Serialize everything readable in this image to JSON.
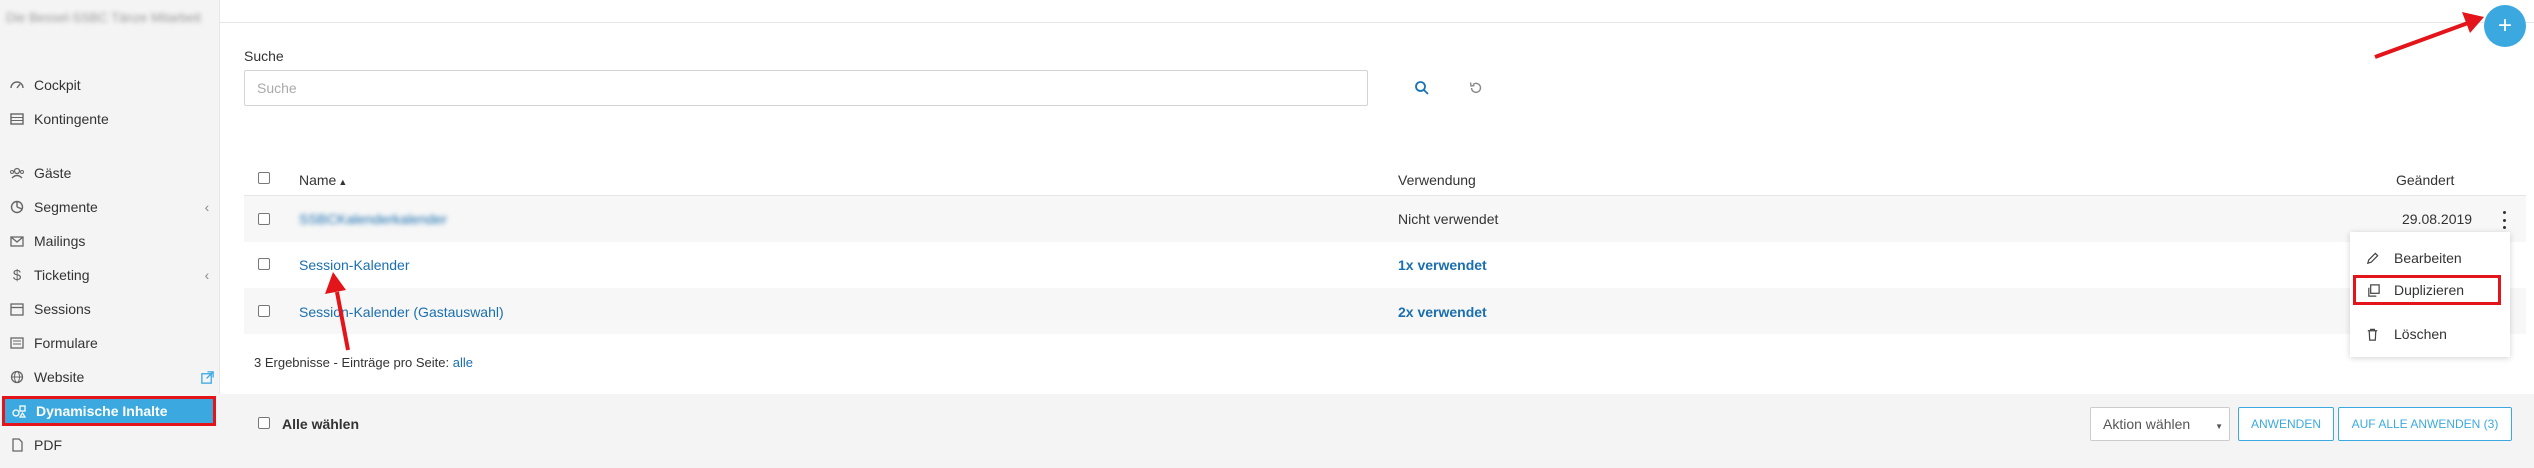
{
  "sidebar": {
    "header": "Die Bessel-SSBC Tänze Mitarbeit",
    "items": [
      {
        "label": "Cockpit",
        "icon": "gauge-icon"
      },
      {
        "label": "Kontingente",
        "icon": "grid-icon"
      },
      {
        "label": "Gäste",
        "icon": "users-icon"
      },
      {
        "label": "Segmente",
        "icon": "segments-icon"
      },
      {
        "label": "Mailings",
        "icon": "mailings-icon"
      },
      {
        "label": "Ticketing",
        "icon": "dollar-icon"
      },
      {
        "label": "Sessions",
        "icon": "calendar-icon"
      },
      {
        "label": "Formulare",
        "icon": "form-icon"
      },
      {
        "label": "Website",
        "icon": "globe-icon"
      },
      {
        "label": "Dynamische Inhalte",
        "icon": "dynamic-content-icon"
      },
      {
        "label": "PDF",
        "icon": "pdf-icon"
      }
    ]
  },
  "search": {
    "label": "Suche",
    "placeholder": "Suche"
  },
  "table": {
    "columns": {
      "name": "Name",
      "usage": "Verwendung",
      "changed": "Geändert"
    },
    "rows": [
      {
        "name": "SSBCKalenderkalender",
        "usage": "Nicht verwendet",
        "changed": "29.08.2019"
      },
      {
        "name": "Session-Kalender",
        "usage": "1x verwendet",
        "changed": ""
      },
      {
        "name": "Session-Kalender (Gastauswahl)",
        "usage": "2x verwendet",
        "changed": ""
      }
    ]
  },
  "results": {
    "count_text": "3 Ergebnisse",
    "per_page_text": " - Einträge pro Seite: ",
    "per_page_value": "alle"
  },
  "context_menu": {
    "edit": "Bearbeiten",
    "duplicate": "Duplizieren",
    "delete": "Löschen"
  },
  "footer": {
    "select_all": "Alle wählen",
    "action_select": "Aktion wählen",
    "apply": "ANWENDEN",
    "apply_all": "AUF ALLE ANWENDEN (3)"
  },
  "fab": {
    "label": "+"
  },
  "colors": {
    "accent": "#3ba9e0",
    "link": "#1a6fb0",
    "annotation_red": "#e3141a"
  }
}
